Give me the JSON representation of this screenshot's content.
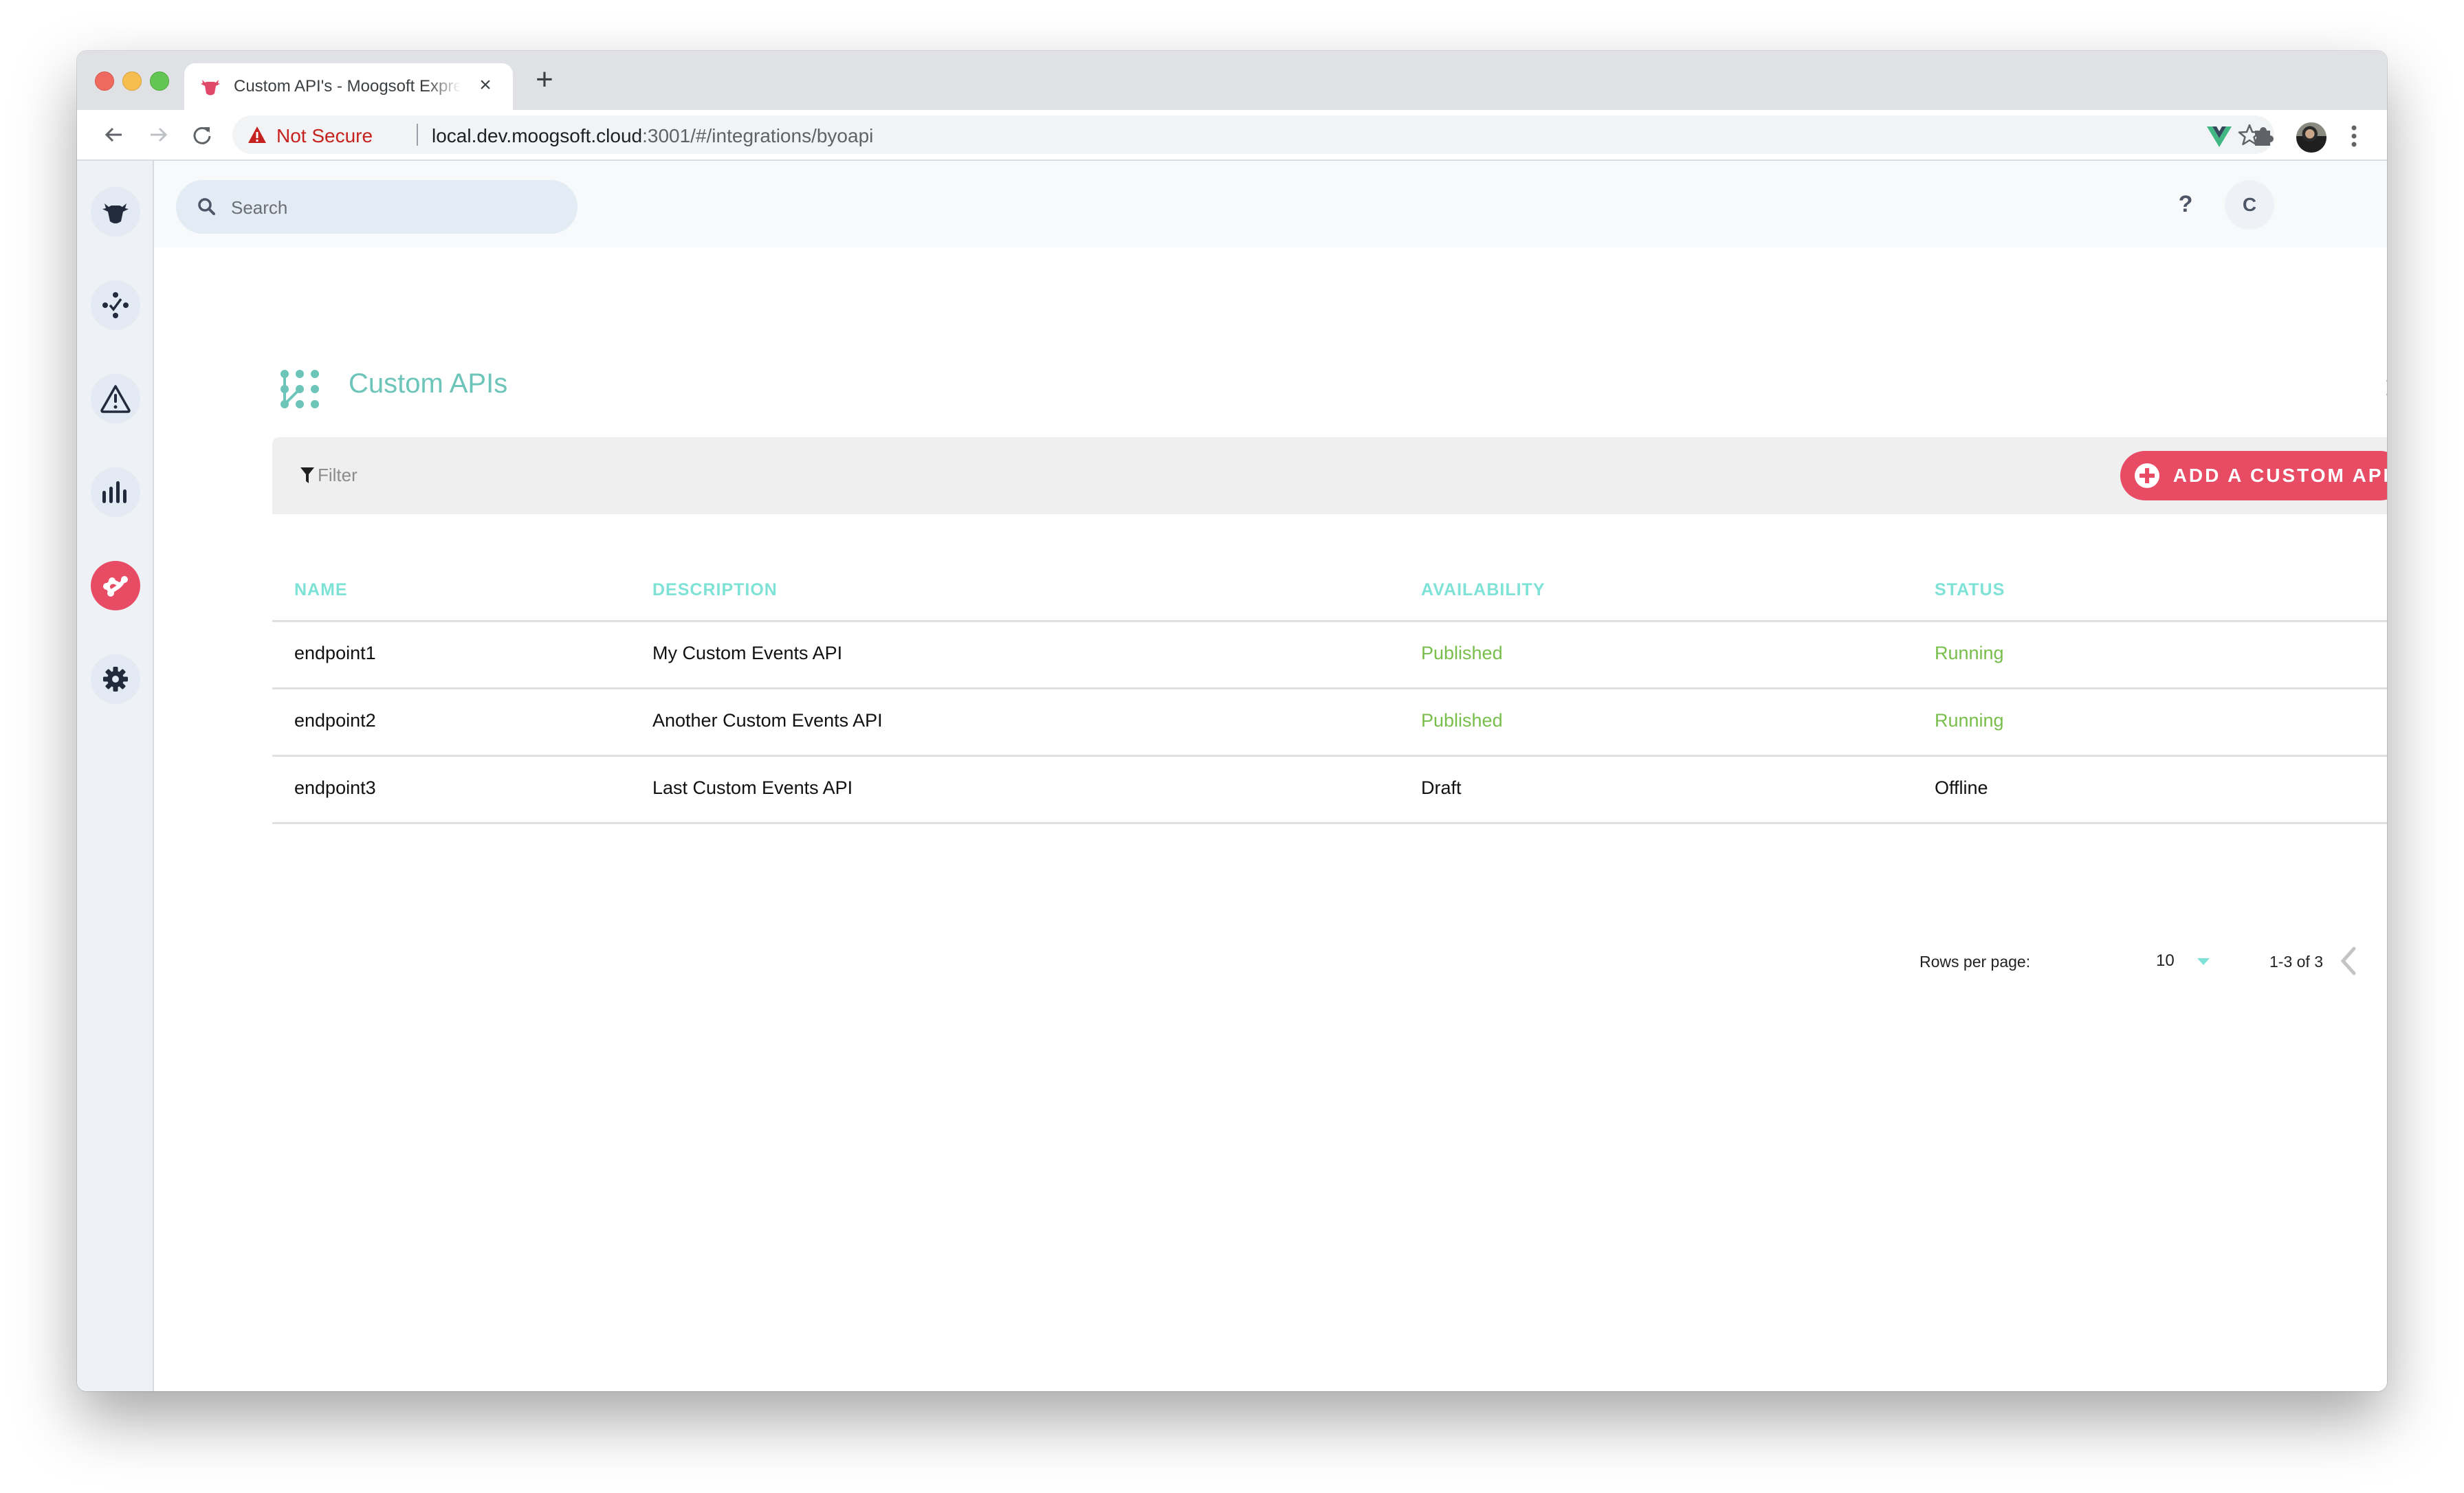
{
  "browser": {
    "tab_title": "Custom API's - Moogsoft Express",
    "tab_close": "×",
    "new_tab": "+",
    "security_label": "Not Secure",
    "url_host": "local.dev.moogsoft.cloud",
    "url_rest": ":3001/#/integrations/byoapi"
  },
  "sidebar": {
    "items": [
      {
        "name": "home",
        "icon": "cow-logo-icon"
      },
      {
        "name": "correlation",
        "icon": "correlation-icon"
      },
      {
        "name": "alerts",
        "icon": "warning-icon"
      },
      {
        "name": "analytics",
        "icon": "bar-chart-icon"
      },
      {
        "name": "integrations",
        "icon": "integrations-icon",
        "active": true
      },
      {
        "name": "settings",
        "icon": "gear-icon"
      }
    ]
  },
  "topbar": {
    "search_placeholder": "Search",
    "help_label": "?",
    "user_initial": "C"
  },
  "page": {
    "title": "Custom APIs",
    "filter_label": "Filter",
    "add_button_label": "ADD A CUSTOM API"
  },
  "table": {
    "columns": [
      "NAME",
      "DESCRIPTION",
      "AVAILABILITY",
      "STATUS"
    ],
    "rows": [
      {
        "name": "endpoint1",
        "description": "My Custom Events API",
        "availability": "Published",
        "status": "Running"
      },
      {
        "name": "endpoint2",
        "description": "Another Custom Events API",
        "availability": "Published",
        "status": "Running"
      },
      {
        "name": "endpoint3",
        "description": "Last Custom Events API",
        "availability": "Draft",
        "status": "Offline"
      }
    ]
  },
  "pagination": {
    "rows_per_page_label": "Rows per page:",
    "rows_per_page_value": "10",
    "range_label": "1-3 of 3"
  },
  "colors": {
    "accent": "#e84c65",
    "title_teal": "#6cc5b8",
    "header_teal": "#7ee3d6",
    "status_green": "#78be4b"
  }
}
